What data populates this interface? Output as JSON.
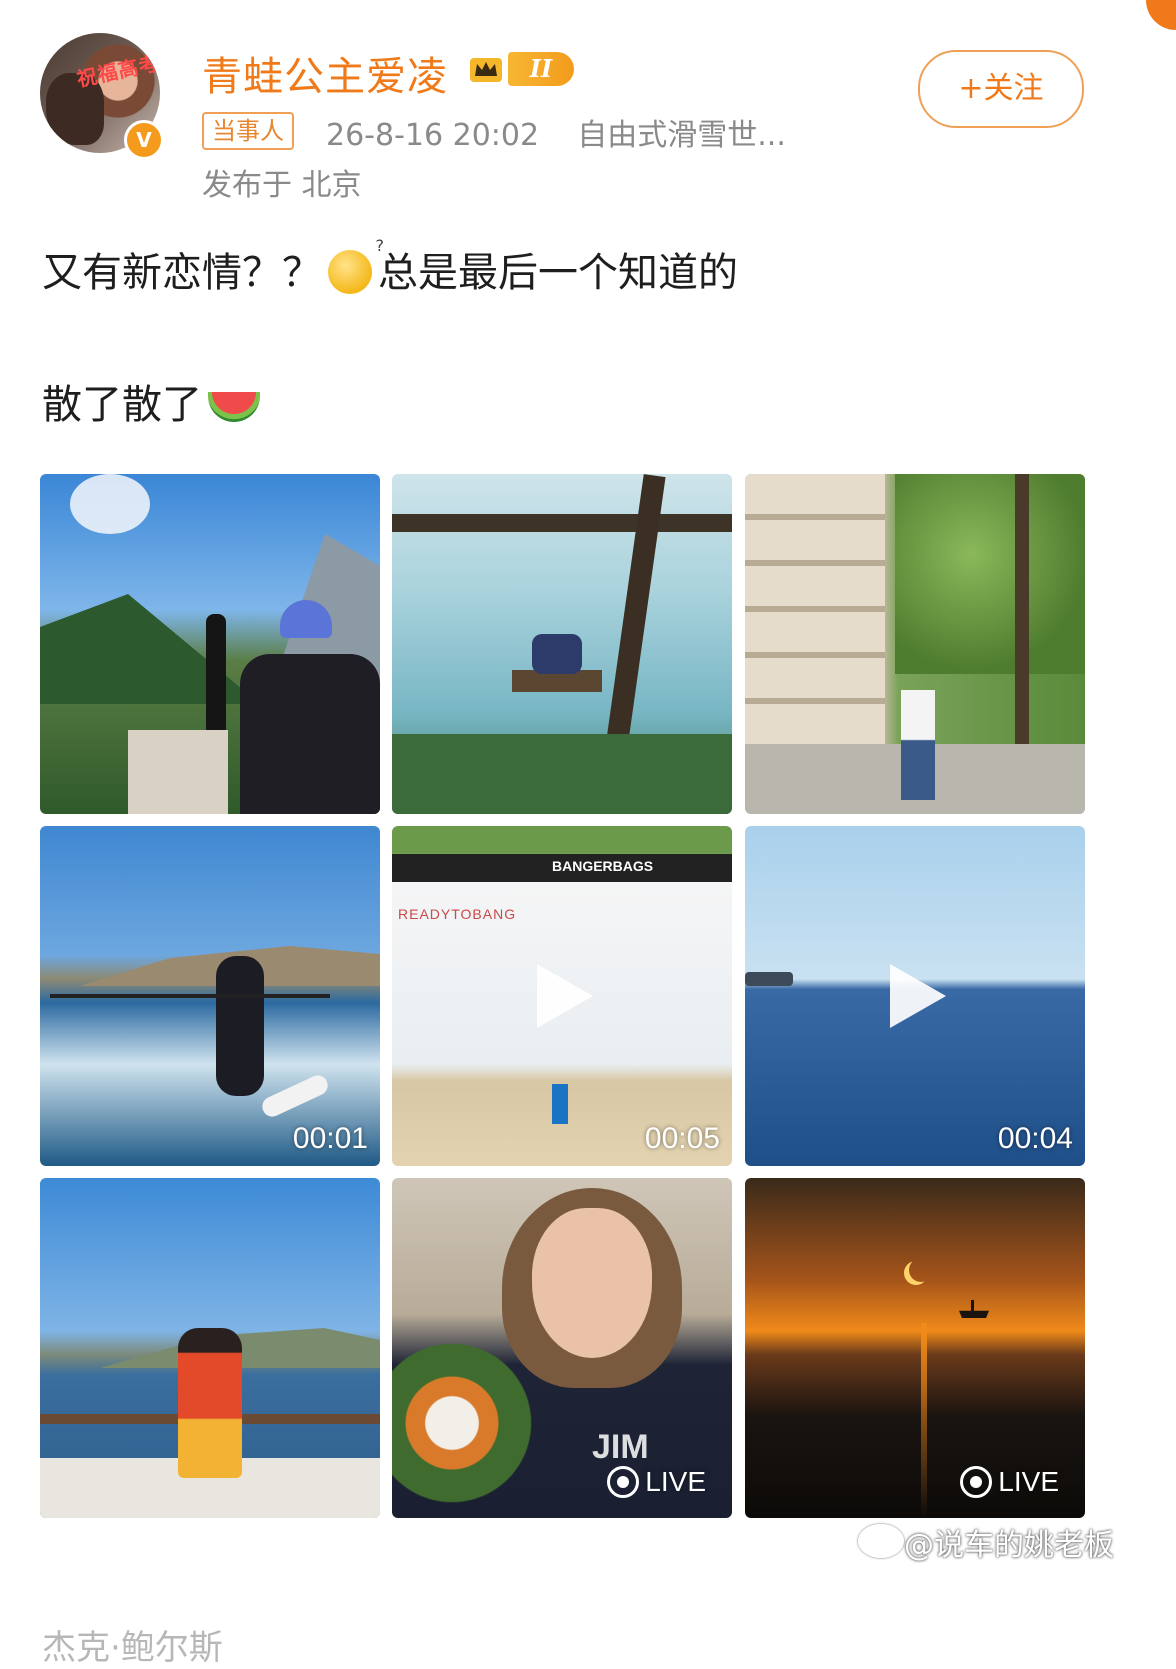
{
  "header": {
    "avatar_caption": "祝福高考",
    "verified_mark": "V",
    "username": "青蛙公主爱凌",
    "level_badge": "II",
    "role_tag": "当事人",
    "timestamp": "26-8-16 20:02",
    "source": "自由式滑雪世...",
    "location": "发布于 北京",
    "follow_label": "+关注",
    "username_color": "#f07a1a"
  },
  "post": {
    "line1_before": "又有新恋情？？",
    "line1_after": "总是最后一个知道的",
    "line2": "散了散了",
    "emoji1": "sweat-smile-emoji",
    "emoji2": "watermelon-emoji"
  },
  "media": [
    {
      "kind": "photo",
      "scene": "skier-mountains"
    },
    {
      "kind": "photo",
      "scene": "swing-lake"
    },
    {
      "kind": "photo",
      "scene": "paris-street"
    },
    {
      "kind": "video",
      "scene": "wakeboard",
      "duration": "00:01"
    },
    {
      "kind": "video",
      "scene": "airbag-ramp",
      "duration": "00:05",
      "signage": "BANGERBAGS",
      "banner": "READYTOBANG"
    },
    {
      "kind": "video",
      "scene": "open-sea",
      "duration": "00:04"
    },
    {
      "kind": "photo",
      "scene": "yacht-dress"
    },
    {
      "kind": "live",
      "scene": "selfie-bouquet",
      "label": "LIVE",
      "shirt_text": "JIM"
    },
    {
      "kind": "live",
      "scene": "sunset-sea",
      "label": "LIVE"
    }
  ],
  "watermark": "@说车的姚老板",
  "cutoff_text": "杰克·鲍尔斯"
}
